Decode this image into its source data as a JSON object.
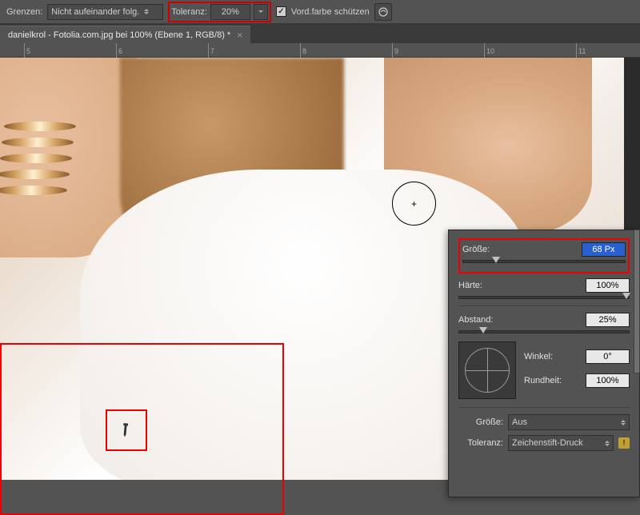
{
  "toolbar": {
    "grenzen_label": "Grenzen:",
    "grenzen_value": "Nicht aufeinander folg.",
    "toleranz_label": "Toleranz:",
    "toleranz_value": "20%",
    "protect_fg_label": "Vord.farbe schützen"
  },
  "document": {
    "tab_title": "danielkrol - Fotolia.com.jpg bei 100% (Ebene 1, RGB/8) *"
  },
  "ruler": {
    "marks": [
      "5",
      "6",
      "7",
      "8",
      "9",
      "10",
      "11"
    ]
  },
  "brush_dialog": {
    "size_label": "Größe:",
    "size_value": "68 Px",
    "hardness_label": "Härte:",
    "hardness_value": "100%",
    "spacing_label": "Abstand:",
    "spacing_value": "25%",
    "angle_label": "Winkel:",
    "angle_value": "0°",
    "roundness_label": "Rundheit:",
    "roundness_value": "100%",
    "size_dyn_label": "Größe:",
    "size_dyn_value": "Aus",
    "tolerance_dyn_label": "Toleranz:",
    "tolerance_dyn_value": "Zeichenstift-Druck"
  }
}
